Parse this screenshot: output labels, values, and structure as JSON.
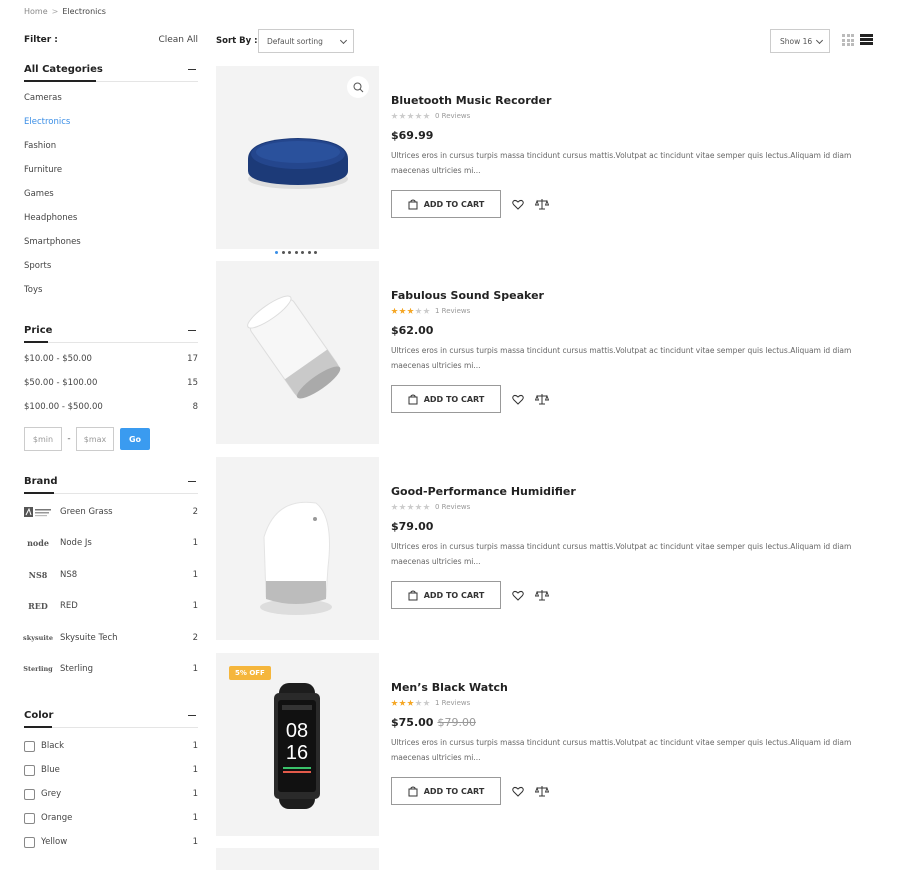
{
  "breadcrumb": {
    "home": "Home",
    "separator": ">",
    "current": "Electronics"
  },
  "filter": {
    "label": "Filter :",
    "clean_all": "Clean All"
  },
  "categories": {
    "title": "All Categories",
    "items": [
      {
        "label": "Cameras"
      },
      {
        "label": "Electronics",
        "active": true
      },
      {
        "label": "Fashion"
      },
      {
        "label": "Furniture"
      },
      {
        "label": "Games"
      },
      {
        "label": "Headphones"
      },
      {
        "label": "Smartphones"
      },
      {
        "label": "Sports"
      },
      {
        "label": "Toys"
      }
    ]
  },
  "price": {
    "title": "Price",
    "ranges": [
      {
        "label": "$10.00 - $50.00",
        "count": "17"
      },
      {
        "label": "$50.00 - $100.00",
        "count": "15"
      },
      {
        "label": "$100.00 - $500.00",
        "count": "8"
      }
    ],
    "min_placeholder": "$min",
    "dash": "-",
    "max_placeholder": "$max",
    "go_label": "Go"
  },
  "brand": {
    "title": "Brand",
    "items": [
      {
        "label": "Green Grass",
        "count": "2",
        "logo": "green-grass-logo"
      },
      {
        "label": "Node Js",
        "count": "1",
        "logo": "node-js-logo",
        "logo_text": "node"
      },
      {
        "label": "NS8",
        "count": "1",
        "logo": "ns8-logo",
        "logo_text": "NS8"
      },
      {
        "label": "RED",
        "count": "1",
        "logo": "red-logo",
        "logo_text": "RED"
      },
      {
        "label": "Skysuite Tech",
        "count": "2",
        "logo": "skysuite-logo",
        "logo_text": "skysuite"
      },
      {
        "label": "Sterling",
        "count": "1",
        "logo": "sterling-logo",
        "logo_text": "Sterling"
      }
    ]
  },
  "color": {
    "title": "Color",
    "items": [
      {
        "label": "Black",
        "count": "1"
      },
      {
        "label": "Blue",
        "count": "1"
      },
      {
        "label": "Grey",
        "count": "1"
      },
      {
        "label": "Orange",
        "count": "1"
      },
      {
        "label": "Yellow",
        "count": "1"
      }
    ]
  },
  "toolbar": {
    "sort_label": "Sort By :",
    "sort_value": "Default sorting",
    "show_value": "Show 16"
  },
  "products": [
    {
      "title": "Bluetooth Music Recorder",
      "rating": 0,
      "reviews": "0 Reviews",
      "price": "$69.99",
      "old_price": "",
      "desc": "Ultrices eros in cursus turpis massa tincidunt cursus mattis.Volutpat ac tincidunt vitae semper quis lectus.Aliquam id diam maecenas ultricies mi...",
      "cart_label": "ADD TO CART",
      "badge": ""
    },
    {
      "title": "Fabulous Sound Speaker",
      "rating": 3,
      "reviews": "1 Reviews",
      "price": "$62.00",
      "old_price": "",
      "desc": "Ultrices eros in cursus turpis massa tincidunt cursus mattis.Volutpat ac tincidunt vitae semper quis lectus.Aliquam id diam maecenas ultricies mi...",
      "cart_label": "ADD TO CART",
      "badge": ""
    },
    {
      "title": "Good-Performance Humidifier",
      "rating": 0,
      "reviews": "0 Reviews",
      "price": "$79.00",
      "old_price": "",
      "desc": "Ultrices eros in cursus turpis massa tincidunt cursus mattis.Volutpat ac tincidunt vitae semper quis lectus.Aliquam id diam maecenas ultricies mi...",
      "cart_label": "ADD TO CART",
      "badge": ""
    },
    {
      "title": "Men’s Black Watch",
      "rating": 3,
      "reviews": "1 Reviews",
      "price": "$75.00",
      "old_price": "$79.00",
      "desc": "Ultrices eros in cursus turpis massa tincidunt cursus mattis.Volutpat ac tincidunt vitae semper quis lectus.Aliquam id diam maecenas ultricies mi...",
      "cart_label": "ADD TO CART",
      "badge": "5% OFF",
      "watch_time_h": "08",
      "watch_time_m": "16"
    }
  ],
  "colors": {
    "accent": "#3a8ee6",
    "star": "#f5a623",
    "badge": "#f5b63c",
    "go_button": "#3a9bf0"
  }
}
